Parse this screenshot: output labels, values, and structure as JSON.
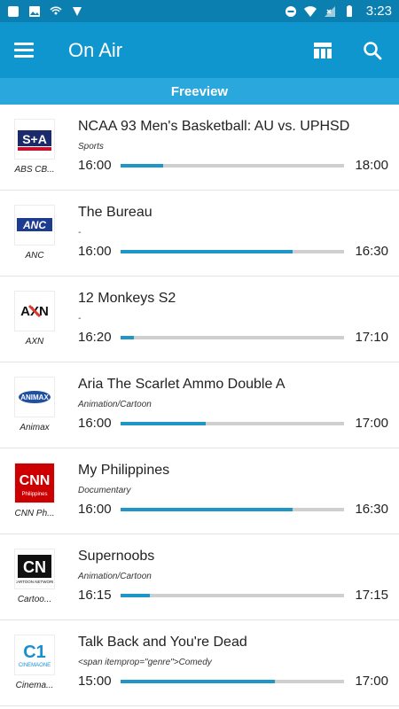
{
  "status": {
    "time": "3:23"
  },
  "app": {
    "title": "On Air"
  },
  "section": {
    "title": "Freeview"
  },
  "rows": [
    {
      "channel": "ABS CB...",
      "title": "NCAA 93 Men's Basketball: AU vs. UPHSD",
      "genre": "Sports",
      "start": "16:00",
      "end": "18:00",
      "progress": 0.19,
      "logo": "s+a"
    },
    {
      "channel": "ANC",
      "title": "The Bureau",
      "genre": "-",
      "start": "16:00",
      "end": "16:30",
      "progress": 0.77,
      "logo": "anc"
    },
    {
      "channel": "AXN",
      "title": "12 Monkeys S2",
      "genre": "-",
      "start": "16:20",
      "end": "17:10",
      "progress": 0.06,
      "logo": "axn"
    },
    {
      "channel": "Animax",
      "title": "Aria The Scarlet Ammo Double A",
      "genre": "Animation/Cartoon",
      "start": "16:00",
      "end": "17:00",
      "progress": 0.38,
      "logo": "animax"
    },
    {
      "channel": "CNN Ph...",
      "title": "My Philippines",
      "genre": "Documentary",
      "start": "16:00",
      "end": "16:30",
      "progress": 0.77,
      "logo": "cnn"
    },
    {
      "channel": "Cartoo...",
      "title": "Supernoobs",
      "genre": "Animation/Cartoon",
      "start": "16:15",
      "end": "17:15",
      "progress": 0.13,
      "logo": "cn"
    },
    {
      "channel": "Cinema...",
      "title": "Talk Back and You're Dead",
      "genre": "<span itemprop=\"genre\">Comedy",
      "start": "15:00",
      "end": "17:00",
      "progress": 0.69,
      "logo": "c1"
    }
  ]
}
